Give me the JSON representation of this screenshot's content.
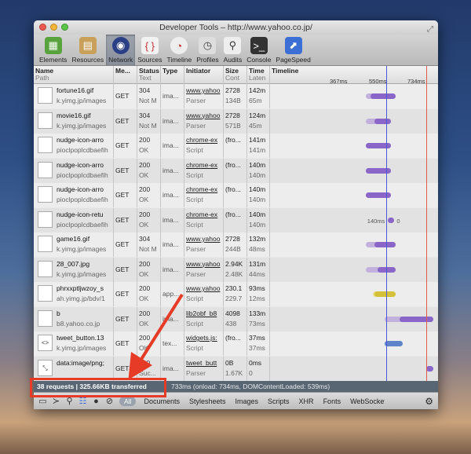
{
  "window": {
    "title": "Developer Tools – http://www.yahoo.co.jp/"
  },
  "toolbar": {
    "items": [
      {
        "label": "Elements",
        "icon": "elements-icon"
      },
      {
        "label": "Resources",
        "icon": "resources-icon"
      },
      {
        "label": "Network",
        "icon": "network-icon",
        "active": true
      },
      {
        "label": "Sources",
        "icon": "sources-icon"
      },
      {
        "label": "Timeline",
        "icon": "timeline-icon"
      },
      {
        "label": "Profiles",
        "icon": "profiles-icon"
      },
      {
        "label": "Audits",
        "icon": "audits-icon"
      },
      {
        "label": "Console",
        "icon": "console-icon"
      },
      {
        "label": "PageSpeed",
        "icon": "pagespeed-icon"
      }
    ]
  },
  "columns": {
    "name": {
      "title": "Name",
      "sub": "Path"
    },
    "method": {
      "title": "Me..."
    },
    "status": {
      "title": "Status",
      "sub": "Text"
    },
    "type": {
      "title": "Type"
    },
    "initiator": {
      "title": "Initiator"
    },
    "size": {
      "title": "Size",
      "sub": "Cont"
    },
    "time": {
      "title": "Time",
      "sub": "Laten"
    },
    "timeline": {
      "title": "Timeline"
    },
    "ticks": [
      "367ms",
      "550ms",
      "734ms"
    ]
  },
  "rows": [
    {
      "name": "fortune16.gif",
      "path": "k.yimg.jp/images",
      "method": "GET",
      "status": "304",
      "status_text": "Not M",
      "type": "ima...",
      "initiator": "www.yahoo",
      "initiator_sub": "Parser",
      "size": "2728",
      "size_b": "134B",
      "time": "142m",
      "time_b": "65m",
      "icon": "gif-icon",
      "bar": {
        "color": "purple",
        "start": 0.57,
        "wait": 0.6,
        "end": 0.75
      }
    },
    {
      "name": "movie16.gif",
      "path": "k.yimg.jp/images",
      "method": "GET",
      "status": "304",
      "status_text": "Not M",
      "type": "ima...",
      "initiator": "www.yahoo",
      "initiator_sub": "Parser",
      "size": "2728",
      "size_b": "571B",
      "time": "124m",
      "time_b": "45m",
      "icon": "gif-icon",
      "bar": {
        "color": "purple",
        "start": 0.57,
        "wait": 0.62,
        "end": 0.72
      }
    },
    {
      "name": "nudge-icon-arro",
      "path": "pioclpoplcdbaefih",
      "method": "GET",
      "status": "200",
      "status_text": "OK",
      "type": "ima...",
      "initiator": "chrome-ex",
      "initiator_sub": "Script",
      "size": "(fro...",
      "size_b": "",
      "time": "141m",
      "time_b": "141m",
      "icon": "image-icon",
      "bar": {
        "color": "purple",
        "start": 0.57,
        "wait": 0.57,
        "end": 0.72
      }
    },
    {
      "name": "nudge-icon-arro",
      "path": "pioclpoplcdbaefih",
      "method": "GET",
      "status": "200",
      "status_text": "OK",
      "type": "ima...",
      "initiator": "chrome-ex",
      "initiator_sub": "Script",
      "size": "(fro...",
      "size_b": "",
      "time": "140m",
      "time_b": "140m",
      "icon": "image-icon",
      "bar": {
        "color": "purple",
        "start": 0.57,
        "wait": 0.57,
        "end": 0.72
      }
    },
    {
      "name": "nudge-icon-arro",
      "path": "pioclpoplcdbaefih",
      "method": "GET",
      "status": "200",
      "status_text": "OK",
      "type": "ima...",
      "initiator": "chrome-ex",
      "initiator_sub": "Script",
      "size": "(fro...",
      "size_b": "",
      "time": "140m",
      "time_b": "140m",
      "icon": "image-icon",
      "bar": {
        "color": "purple",
        "start": 0.57,
        "wait": 0.57,
        "end": 0.72
      }
    },
    {
      "name": "nudge-icon-retu",
      "path": "pioclpoplcdbaefih",
      "method": "GET",
      "status": "200",
      "status_text": "OK",
      "type": "ima...",
      "initiator": "chrome-ex",
      "initiator_sub": "Script",
      "size": "(fro...",
      "size_b": "",
      "time": "140m",
      "time_b": "140m",
      "icon": "image-icon",
      "label": "140ms",
      "label2": "0",
      "bar": {
        "color": "purple",
        "start": 0.7,
        "wait": 0.7,
        "end": 0.74
      }
    },
    {
      "name": "game16.gif",
      "path": "k.yimg.jp/images",
      "method": "GET",
      "status": "304",
      "status_text": "Not M",
      "type": "ima...",
      "initiator": "www.yahoo",
      "initiator_sub": "Parser",
      "size": "2728",
      "size_b": "244B",
      "time": "132m",
      "time_b": "48ms",
      "icon": "gif-icon",
      "bar": {
        "color": "purple",
        "start": 0.57,
        "wait": 0.62,
        "end": 0.75
      }
    },
    {
      "name": "28_007.jpg",
      "path": "k.yimg.jp/images",
      "method": "GET",
      "status": "200",
      "status_text": "OK",
      "type": "ima...",
      "initiator": "www.yahoo",
      "initiator_sub": "Parser",
      "size": "2.94K",
      "size_b": "2.48K",
      "time": "131m",
      "time_b": "44ms",
      "icon": "jpg-icon",
      "bar": {
        "color": "purple",
        "start": 0.57,
        "wait": 0.64,
        "end": 0.75
      }
    },
    {
      "name": "phrxxptljwzoy_s",
      "path": "ah.yimg.jp/bdv/1",
      "method": "GET",
      "status": "200",
      "status_text": "OK",
      "type": "app...",
      "initiator": "www.yahoo",
      "initiator_sub": "Script",
      "size": "230.1",
      "size_b": "229.7",
      "time": "93ms",
      "time_b": "12ms",
      "icon": "script-icon",
      "bar": {
        "color": "yellow",
        "start": 0.61,
        "wait": 0.62,
        "end": 0.75
      }
    },
    {
      "name": "b",
      "path": "b8.yahoo.co.jp",
      "method": "GET",
      "status": "200",
      "status_text": "OK",
      "type": "ima...",
      "initiator": "lib2obf_b8",
      "initiator_sub": "Script",
      "size": "4098",
      "size_b": "438",
      "time": "133m",
      "time_b": "73ms",
      "icon": "image-icon",
      "bar": {
        "color": "purple",
        "start": 0.68,
        "wait": 0.77,
        "end": 0.97
      }
    },
    {
      "name": "tweet_button.13",
      "path": "k.yimg.jp/images",
      "method": "GET",
      "status": "200",
      "status_text": "OK",
      "type": "tex...",
      "initiator": "widgets.js:",
      "initiator_sub": "Script",
      "size": "(fro...",
      "size_b": "",
      "time": "37ms",
      "time_b": "37ms",
      "icon": "html-icon",
      "bar": {
        "color": "blue",
        "start": 0.68,
        "wait": 0.68,
        "end": 0.79
      }
    },
    {
      "name": "data:image/png;",
      "path": "",
      "method": "GET",
      "status": "200",
      "status_text": "Suc...",
      "type": "ima...",
      "initiator": "tweet_butt",
      "initiator_sub": "Parser",
      "size": "0B",
      "size_b": "1.67K",
      "time": "0ms",
      "time_b": "0",
      "icon": "data-icon",
      "bar": {
        "color": "purple",
        "start": 0.93,
        "wait": 0.93,
        "end": 0.97
      }
    }
  ],
  "status": {
    "summary": "38 requests  |  325.66KB transferred",
    "load": "733ms (onload: 734ms, DOMContentLoaded: 539ms)"
  },
  "filters": [
    "All",
    "Documents",
    "Stylesheets",
    "Images",
    "Scripts",
    "XHR",
    "Fonts",
    "WebSockets"
  ],
  "colors": {
    "accent": "#e63b26",
    "loadLine": "#e15a4b",
    "domLine": "#4b58d8"
  }
}
